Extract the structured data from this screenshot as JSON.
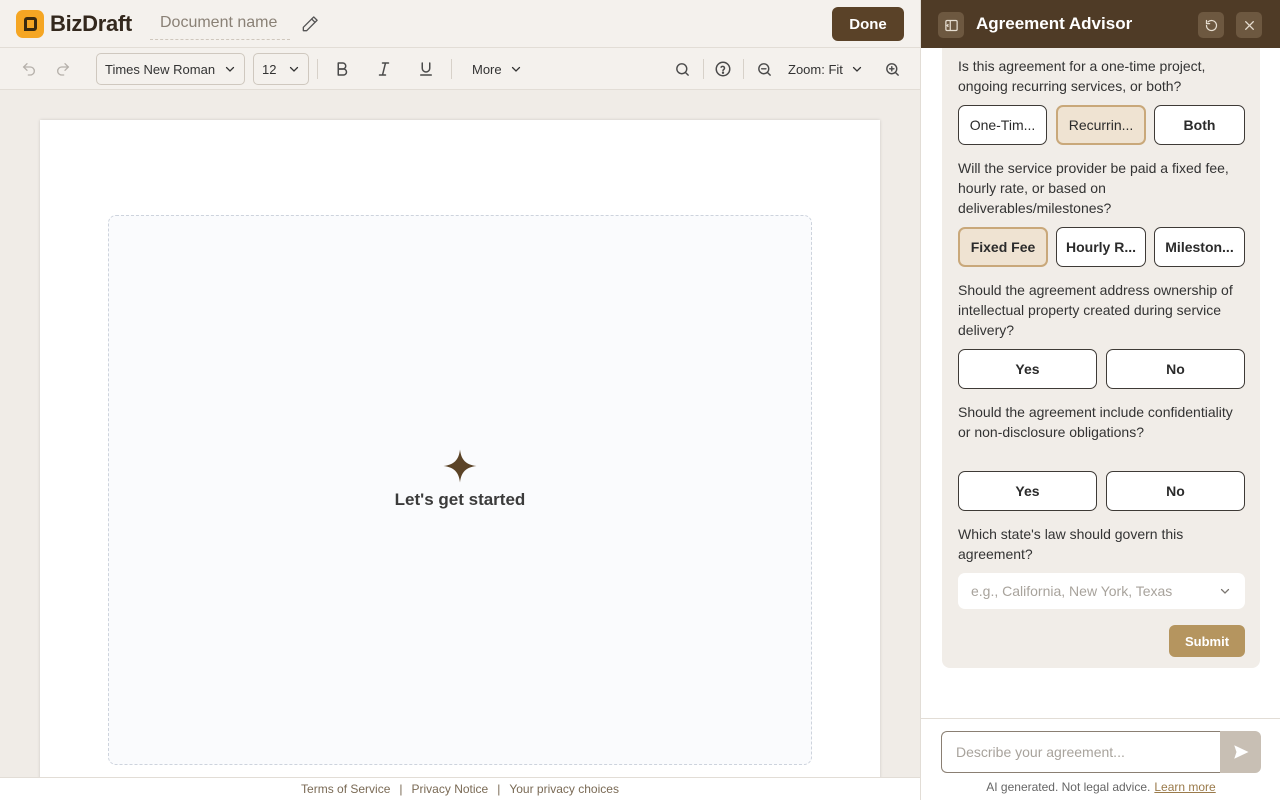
{
  "app": {
    "brand": "BizDraft",
    "document_name_placeholder": "Document name",
    "done_label": "Done"
  },
  "toolbar": {
    "font_family": "Times New Roman",
    "font_size": "12",
    "more_label": "More",
    "zoom_label": "Zoom: Fit"
  },
  "canvas": {
    "start_text": "Let's get started"
  },
  "footer": {
    "links": [
      "Terms of Service",
      "Privacy Notice",
      "Your privacy choices"
    ]
  },
  "advisor": {
    "title": "Agreement Advisor",
    "questions": [
      {
        "text": "Is this agreement for a one-time project, ongoing recurring services, or both?",
        "options": [
          "One-Tim...",
          "Recurrin...",
          "Both"
        ],
        "selected": 1
      },
      {
        "text": "Will the service provider be paid a fixed fee, hourly rate, or based on deliverables/milestones?",
        "options": [
          "Fixed Fee",
          "Hourly R...",
          "Mileston..."
        ],
        "selected": 0
      },
      {
        "text": "Should the agreement address ownership of intellectual property created during service delivery?",
        "options": [
          "Yes",
          "No"
        ],
        "selected": null
      },
      {
        "text": "Should the agreement include confidentiality or non-disclosure obligations?",
        "options": [
          "Yes",
          "No"
        ],
        "selected": null
      },
      {
        "text": "Which state's law should govern this agreement?",
        "placeholder": "e.g., California, New York, Texas"
      }
    ],
    "submit_label": "Submit",
    "chat_placeholder": "Describe your agreement...",
    "disclaimer": "AI generated. Not legal advice.",
    "learn_more": "Learn more"
  },
  "colors": {
    "brand_accent": "#f5a623",
    "header_dark": "#4f3b26",
    "done_button": "#5a4228",
    "selected_option_bg": "#efe3d2",
    "submit_button": "#b5955f"
  }
}
